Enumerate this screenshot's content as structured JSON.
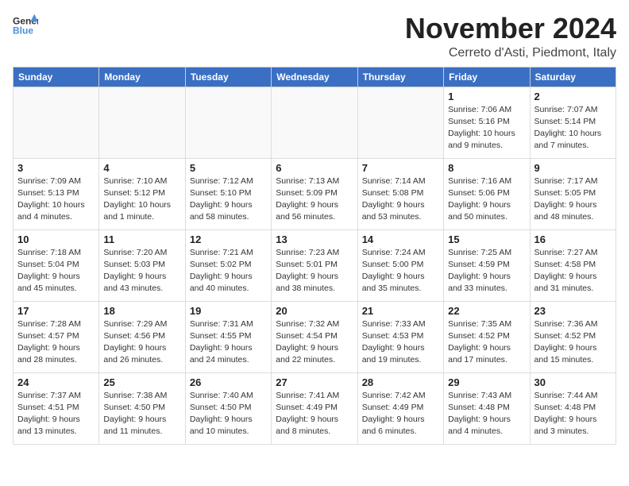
{
  "logo": {
    "line1": "General",
    "line2": "Blue"
  },
  "title": {
    "month_year": "November 2024",
    "location": "Cerreto d'Asti, Piedmont, Italy"
  },
  "weekdays": [
    "Sunday",
    "Monday",
    "Tuesday",
    "Wednesday",
    "Thursday",
    "Friday",
    "Saturday"
  ],
  "weeks": [
    [
      {
        "day": "",
        "info": ""
      },
      {
        "day": "",
        "info": ""
      },
      {
        "day": "",
        "info": ""
      },
      {
        "day": "",
        "info": ""
      },
      {
        "day": "",
        "info": ""
      },
      {
        "day": "1",
        "info": "Sunrise: 7:06 AM\nSunset: 5:16 PM\nDaylight: 10 hours and 9 minutes."
      },
      {
        "day": "2",
        "info": "Sunrise: 7:07 AM\nSunset: 5:14 PM\nDaylight: 10 hours and 7 minutes."
      }
    ],
    [
      {
        "day": "3",
        "info": "Sunrise: 7:09 AM\nSunset: 5:13 PM\nDaylight: 10 hours and 4 minutes."
      },
      {
        "day": "4",
        "info": "Sunrise: 7:10 AM\nSunset: 5:12 PM\nDaylight: 10 hours and 1 minute."
      },
      {
        "day": "5",
        "info": "Sunrise: 7:12 AM\nSunset: 5:10 PM\nDaylight: 9 hours and 58 minutes."
      },
      {
        "day": "6",
        "info": "Sunrise: 7:13 AM\nSunset: 5:09 PM\nDaylight: 9 hours and 56 minutes."
      },
      {
        "day": "7",
        "info": "Sunrise: 7:14 AM\nSunset: 5:08 PM\nDaylight: 9 hours and 53 minutes."
      },
      {
        "day": "8",
        "info": "Sunrise: 7:16 AM\nSunset: 5:06 PM\nDaylight: 9 hours and 50 minutes."
      },
      {
        "day": "9",
        "info": "Sunrise: 7:17 AM\nSunset: 5:05 PM\nDaylight: 9 hours and 48 minutes."
      }
    ],
    [
      {
        "day": "10",
        "info": "Sunrise: 7:18 AM\nSunset: 5:04 PM\nDaylight: 9 hours and 45 minutes."
      },
      {
        "day": "11",
        "info": "Sunrise: 7:20 AM\nSunset: 5:03 PM\nDaylight: 9 hours and 43 minutes."
      },
      {
        "day": "12",
        "info": "Sunrise: 7:21 AM\nSunset: 5:02 PM\nDaylight: 9 hours and 40 minutes."
      },
      {
        "day": "13",
        "info": "Sunrise: 7:23 AM\nSunset: 5:01 PM\nDaylight: 9 hours and 38 minutes."
      },
      {
        "day": "14",
        "info": "Sunrise: 7:24 AM\nSunset: 5:00 PM\nDaylight: 9 hours and 35 minutes."
      },
      {
        "day": "15",
        "info": "Sunrise: 7:25 AM\nSunset: 4:59 PM\nDaylight: 9 hours and 33 minutes."
      },
      {
        "day": "16",
        "info": "Sunrise: 7:27 AM\nSunset: 4:58 PM\nDaylight: 9 hours and 31 minutes."
      }
    ],
    [
      {
        "day": "17",
        "info": "Sunrise: 7:28 AM\nSunset: 4:57 PM\nDaylight: 9 hours and 28 minutes."
      },
      {
        "day": "18",
        "info": "Sunrise: 7:29 AM\nSunset: 4:56 PM\nDaylight: 9 hours and 26 minutes."
      },
      {
        "day": "19",
        "info": "Sunrise: 7:31 AM\nSunset: 4:55 PM\nDaylight: 9 hours and 24 minutes."
      },
      {
        "day": "20",
        "info": "Sunrise: 7:32 AM\nSunset: 4:54 PM\nDaylight: 9 hours and 22 minutes."
      },
      {
        "day": "21",
        "info": "Sunrise: 7:33 AM\nSunset: 4:53 PM\nDaylight: 9 hours and 19 minutes."
      },
      {
        "day": "22",
        "info": "Sunrise: 7:35 AM\nSunset: 4:52 PM\nDaylight: 9 hours and 17 minutes."
      },
      {
        "day": "23",
        "info": "Sunrise: 7:36 AM\nSunset: 4:52 PM\nDaylight: 9 hours and 15 minutes."
      }
    ],
    [
      {
        "day": "24",
        "info": "Sunrise: 7:37 AM\nSunset: 4:51 PM\nDaylight: 9 hours and 13 minutes."
      },
      {
        "day": "25",
        "info": "Sunrise: 7:38 AM\nSunset: 4:50 PM\nDaylight: 9 hours and 11 minutes."
      },
      {
        "day": "26",
        "info": "Sunrise: 7:40 AM\nSunset: 4:50 PM\nDaylight: 9 hours and 10 minutes."
      },
      {
        "day": "27",
        "info": "Sunrise: 7:41 AM\nSunset: 4:49 PM\nDaylight: 9 hours and 8 minutes."
      },
      {
        "day": "28",
        "info": "Sunrise: 7:42 AM\nSunset: 4:49 PM\nDaylight: 9 hours and 6 minutes."
      },
      {
        "day": "29",
        "info": "Sunrise: 7:43 AM\nSunset: 4:48 PM\nDaylight: 9 hours and 4 minutes."
      },
      {
        "day": "30",
        "info": "Sunrise: 7:44 AM\nSunset: 4:48 PM\nDaylight: 9 hours and 3 minutes."
      }
    ]
  ]
}
